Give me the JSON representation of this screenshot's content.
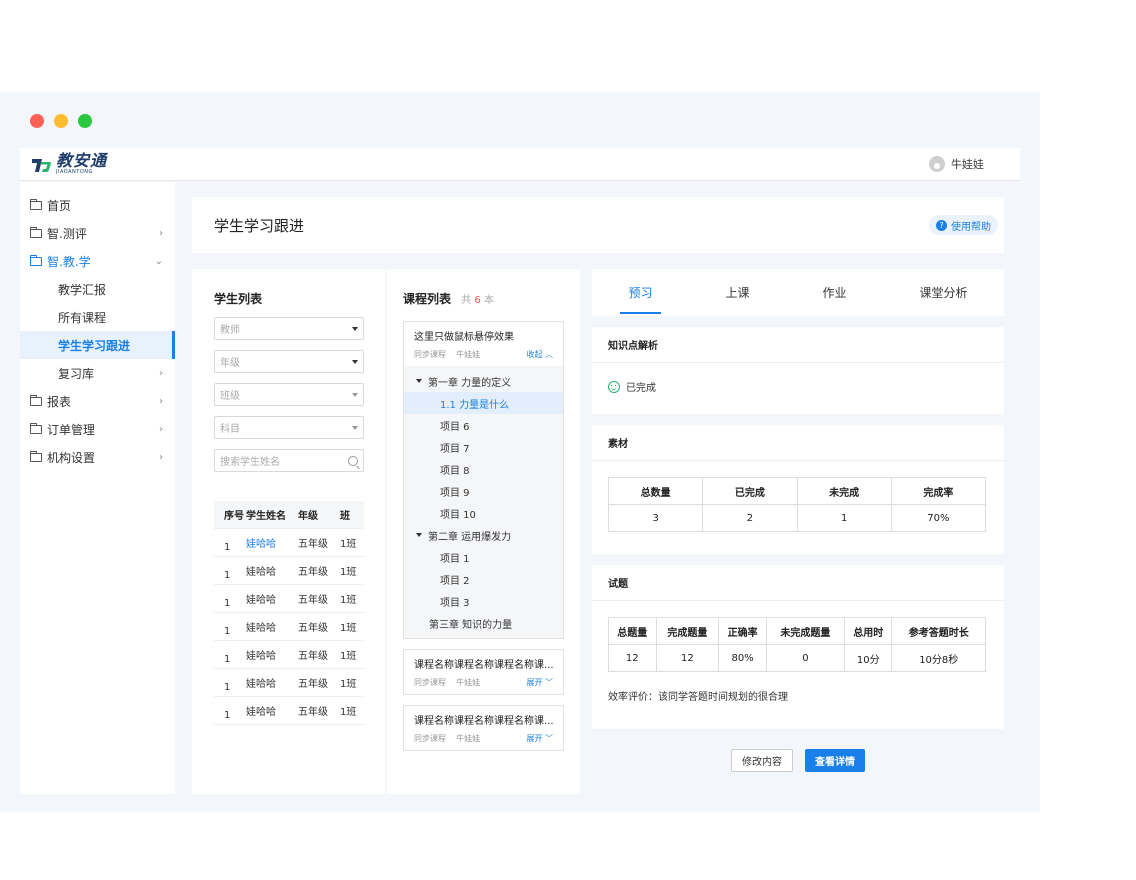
{
  "app": {
    "logo_cn": "教安通",
    "logo_en": "JIAOANTONG",
    "user_name": "牛娃娃"
  },
  "sidebar": {
    "items": [
      {
        "label": "首页"
      },
      {
        "label": "智.测评"
      },
      {
        "label": "智.教.学"
      },
      {
        "label": "教学汇报"
      },
      {
        "label": "所有课程"
      },
      {
        "label": "学生学习跟进"
      },
      {
        "label": "复习库"
      },
      {
        "label": "报表"
      },
      {
        "label": "订单管理"
      },
      {
        "label": "机构设置"
      }
    ]
  },
  "page": {
    "title": "学生学习跟进",
    "help_label": "使用帮助"
  },
  "students": {
    "title": "学生列表",
    "filters": {
      "teacher": "教师",
      "grade": "年级",
      "class": "班级",
      "subject": "科目"
    },
    "search_placeholder": "搜索学生姓名",
    "columns": [
      "序号",
      "学生姓名",
      "年级",
      "班"
    ],
    "rows": [
      [
        "1",
        "娃哈哈",
        "五年级",
        "1班"
      ],
      [
        "1",
        "娃哈哈",
        "五年级",
        "1班"
      ],
      [
        "1",
        "娃哈哈",
        "五年级",
        "1班"
      ],
      [
        "1",
        "娃哈哈",
        "五年级",
        "1班"
      ],
      [
        "1",
        "娃哈哈",
        "五年级",
        "1班"
      ],
      [
        "1",
        "娃哈哈",
        "五年级",
        "1班"
      ],
      [
        "1",
        "娃哈哈",
        "五年级",
        "1班"
      ]
    ]
  },
  "courses": {
    "title": "课程列表",
    "count_prefix": "共",
    "count": "6",
    "count_suffix": "本",
    "expanded": {
      "title": "这里只做鼠标悬停效果",
      "type": "同步课程",
      "teacher": "牛娃娃",
      "toggle": "收起",
      "tree": [
        {
          "label": "第一章 力量的定义"
        },
        {
          "label": "1.1 力量是什么"
        },
        {
          "label": "项目 6"
        },
        {
          "label": "项目 7"
        },
        {
          "label": "项目 8"
        },
        {
          "label": "项目 9"
        },
        {
          "label": "项目 10"
        },
        {
          "label": "第二章 运用爆发力"
        },
        {
          "label": "项目 1"
        },
        {
          "label": "项目 2"
        },
        {
          "label": "项目 3"
        },
        {
          "label": "第三章 知识的力量"
        }
      ]
    },
    "collapsed": [
      {
        "title": "课程名称课程名称课程名称课...",
        "type": "同步课程",
        "teacher": "牛娃娃",
        "toggle": "展开"
      },
      {
        "title": "课程名称课程名称课程名称课...",
        "type": "同步课程",
        "teacher": "牛娃娃",
        "toggle": "展开"
      }
    ]
  },
  "detail": {
    "tabs": [
      "预习",
      "上课",
      "作业",
      "课堂分析"
    ],
    "knowledge": {
      "title": "知识点解析",
      "status": "已完成"
    },
    "material": {
      "title": "素材",
      "columns": [
        "总数量",
        "已完成",
        "未完成",
        "完成率"
      ],
      "values": [
        "3",
        "2",
        "1",
        "70%"
      ]
    },
    "questions": {
      "title": "试题",
      "columns": [
        "总题量",
        "完成题量",
        "正确率",
        "未完成题量",
        "总用时",
        "参考答题时长"
      ],
      "values": [
        "12",
        "12",
        "80%",
        "0",
        "10分",
        "10分8秒"
      ],
      "evaluation": "效率评价：该同学答题时间规划的很合理"
    },
    "actions": {
      "edit": "修改内容",
      "view": "查看详情"
    }
  },
  "colors": {
    "accent": "#1a7fe8",
    "success": "#27b36a",
    "count": "#e55555"
  }
}
